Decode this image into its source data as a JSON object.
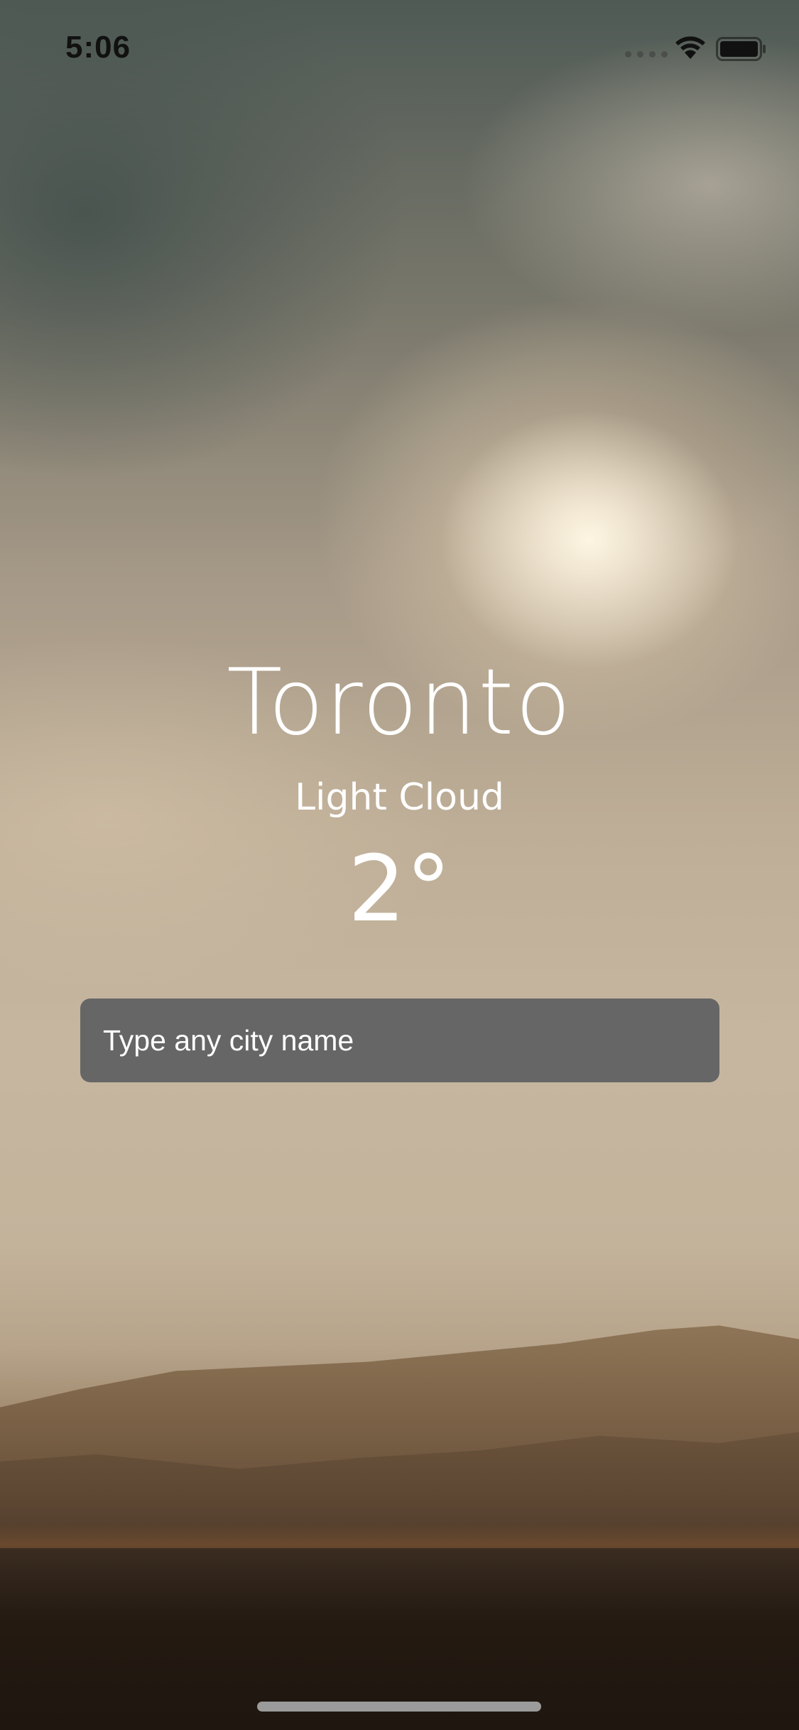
{
  "status_bar": {
    "time": "5:06"
  },
  "weather": {
    "city": "Toronto",
    "condition": "Light Cloud",
    "temperature": "2°"
  },
  "search": {
    "placeholder": "Type any city name",
    "value": ""
  },
  "icons": {
    "signal": "cellular-signal-icon",
    "wifi": "wifi-icon",
    "battery": "battery-icon"
  }
}
